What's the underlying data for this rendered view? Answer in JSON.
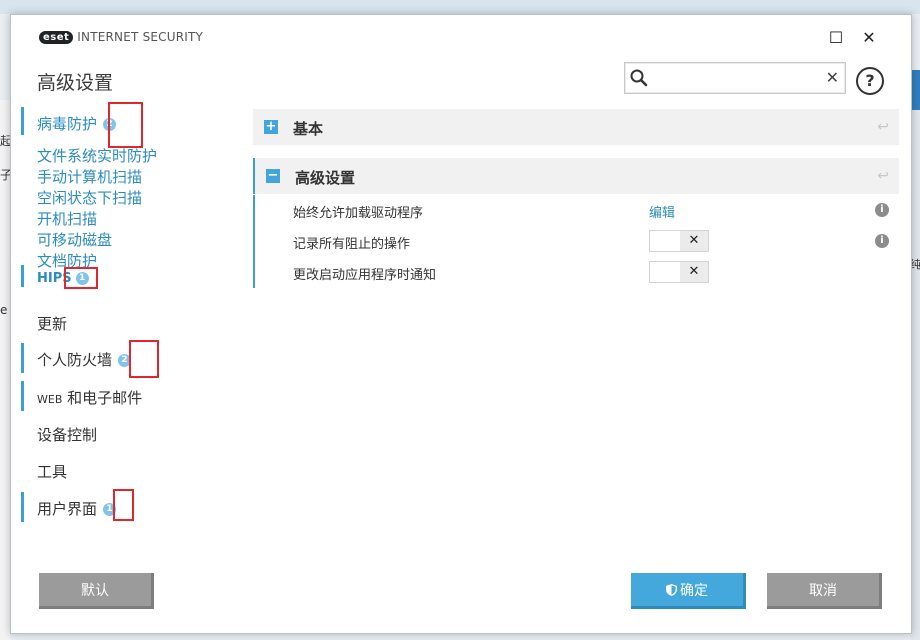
{
  "titlebar": {
    "logo_badge": "eset",
    "product": "INTERNET SECURITY",
    "maximize_glyph": "☐",
    "close_glyph": "✕"
  },
  "page_title": "高级设置",
  "search": {
    "value": "",
    "placeholder": "",
    "clear_glyph": "✕",
    "help_glyph": "?"
  },
  "nav": {
    "antivirus": {
      "label": "病毒防护",
      "badge": "2"
    },
    "sub_items": [
      "文件系统实时防护",
      "手动计算机扫描",
      "空闲状态下扫描",
      "开机扫描",
      "可移动磁盘",
      "文档防护"
    ],
    "hips": {
      "label": "HIPS",
      "badge": "1"
    },
    "update": {
      "label": "更新"
    },
    "firewall": {
      "label": "个人防火墙",
      "badge": "2"
    },
    "web_email": {
      "label_prefix": "WEB",
      "label_suffix": " 和电子邮件"
    },
    "device_control": {
      "label": "设备控制"
    },
    "tools": {
      "label": "工具"
    },
    "ui": {
      "label": "用户界面",
      "badge": "1"
    }
  },
  "sections": {
    "basic": {
      "label": "基本",
      "toggle": "+",
      "reset": "↩"
    },
    "advanced": {
      "label": "高级设置",
      "toggle": "−",
      "reset": "↩"
    }
  },
  "rows": [
    {
      "label": "始终允许加载驱动程序",
      "link": "编辑",
      "info": "i"
    },
    {
      "label": "记录所有阻止的操作",
      "toggle": "✕",
      "info": "i"
    },
    {
      "label": "更改启动应用程序时通知",
      "toggle": "✕"
    }
  ],
  "buttons": {
    "default": "默认",
    "ok": "确定",
    "cancel": "取消"
  },
  "bg_fragments": {
    "a": "起",
    "b": "子",
    "c": "e",
    "d": "纯"
  },
  "colors": {
    "accent": "#45a8dc",
    "link": "#2b8cbf",
    "badge": "#7fc4ea",
    "highlight": "#e0272b",
    "gray_button": "#9b9b9b"
  }
}
